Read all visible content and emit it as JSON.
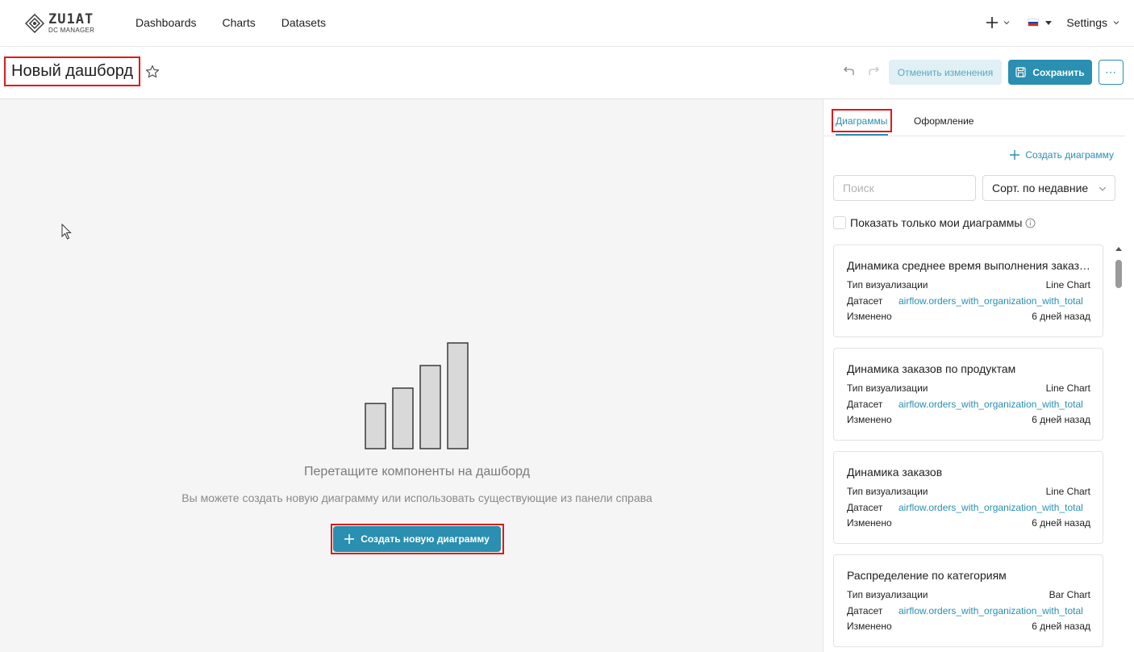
{
  "topnav": {
    "logo": {
      "word": "ZU1AT",
      "sub": "DC MANAGER"
    },
    "links": [
      "Dashboards",
      "Charts",
      "Datasets"
    ],
    "plus_icon": "plus-icon",
    "language_flag": "russian-flag",
    "settings_label": "Settings"
  },
  "header": {
    "title": "Новый дашборд",
    "star_icon": "star-icon",
    "discard_label": "Отменить изменения",
    "save_label": "Сохранить",
    "more_icon": "ellipsis-icon"
  },
  "canvas": {
    "empty_title": "Перетащите компоненты на дашборд",
    "empty_subtitle": "Вы можете создать новую диаграмму или использовать существующие из панели справа",
    "create_button_label": "Создать новую диаграмму"
  },
  "sidebar": {
    "tabs": [
      "Диаграммы",
      "Оформление"
    ],
    "active_tab": "Диаграммы",
    "create_link": "Создать диаграмму",
    "search": {
      "placeholder": "Поиск",
      "value": ""
    },
    "sort_selected": "Сорт. по недавние",
    "show_mine_label": "Показать только мои диаграммы",
    "labels": {
      "viz_type": "Тип визуализации",
      "dataset": "Датасет",
      "modified": "Изменено"
    },
    "cards": [
      {
        "title": "Динамика среднее время выполнения заказов",
        "viz_type": "Line Chart",
        "dataset": "airflow.orders_with_organization_with_total",
        "modified": "6 дней назад"
      },
      {
        "title": "Динамика заказов по продуктам",
        "viz_type": "Line Chart",
        "dataset": "airflow.orders_with_organization_with_total",
        "modified": "6 дней назад"
      },
      {
        "title": "Динамика заказов",
        "viz_type": "Line Chart",
        "dataset": "airflow.orders_with_organization_with_total",
        "modified": "6 дней назад"
      },
      {
        "title": "Распределение по категориям",
        "viz_type": "Bar Chart",
        "dataset": "airflow.orders_with_organization_with_total",
        "modified": "6 дней назад"
      }
    ]
  },
  "colors": {
    "accent": "#2a8fb0",
    "accent_light": "#e0f0f4",
    "highlight": "#e0181b",
    "canvas_bg": "#f5f5f5"
  }
}
